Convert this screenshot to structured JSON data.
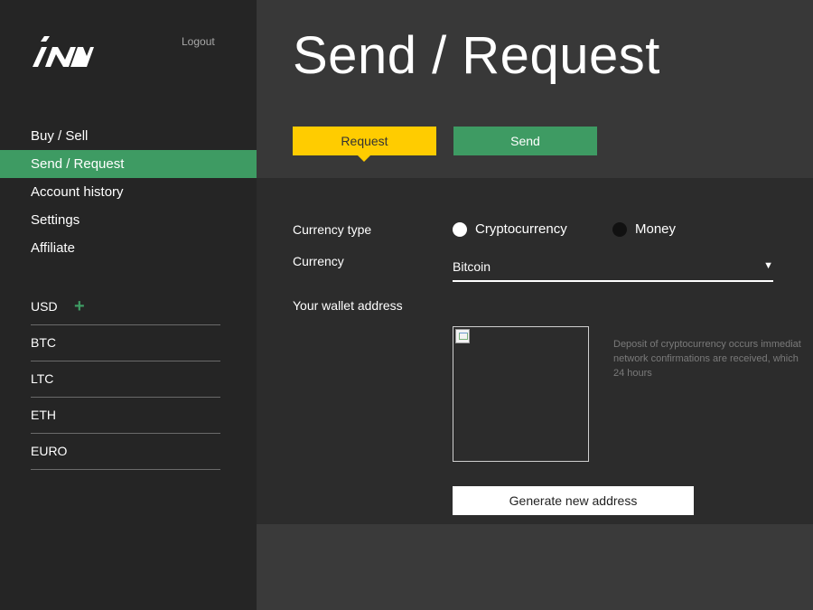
{
  "sidebar": {
    "logout_label": "Logout",
    "nav": [
      {
        "label": "Buy / Sell"
      },
      {
        "label": "Send / Request",
        "active": true
      },
      {
        "label": "Account history"
      },
      {
        "label": "Settings"
      },
      {
        "label": "Affiliate"
      }
    ],
    "currencies": [
      {
        "label": "USD",
        "has_add": true
      },
      {
        "label": "BTC"
      },
      {
        "label": "LTC"
      },
      {
        "label": "ETH"
      },
      {
        "label": "EURO"
      }
    ],
    "add_symbol": "+"
  },
  "header": {
    "title": "Send / Request",
    "tabs": {
      "request_label": "Request",
      "send_label": "Send"
    }
  },
  "form": {
    "currency_type_label": "Currency type",
    "currency_type_options": [
      {
        "label": "Cryptocurrency",
        "selected": true
      },
      {
        "label": "Money",
        "selected": false
      }
    ],
    "currency_label": "Currency",
    "currency_value": "Bitcoin",
    "wallet_label": "Your wallet address",
    "deposit_note_lines": [
      "Deposit of cryptocurrency occurs immediat",
      "network confirmations are received, which",
      "24 hours"
    ],
    "generate_button_label": "Generate new address"
  },
  "colors": {
    "accent_green": "#3e9b63",
    "accent_yellow": "#ffcc00",
    "sidebar_bg": "#252525",
    "panel_bg": "#2c2c2c"
  },
  "icons": {
    "logo": "brand-logo",
    "caret": "caret-down-icon",
    "qr": "broken-image-icon"
  }
}
